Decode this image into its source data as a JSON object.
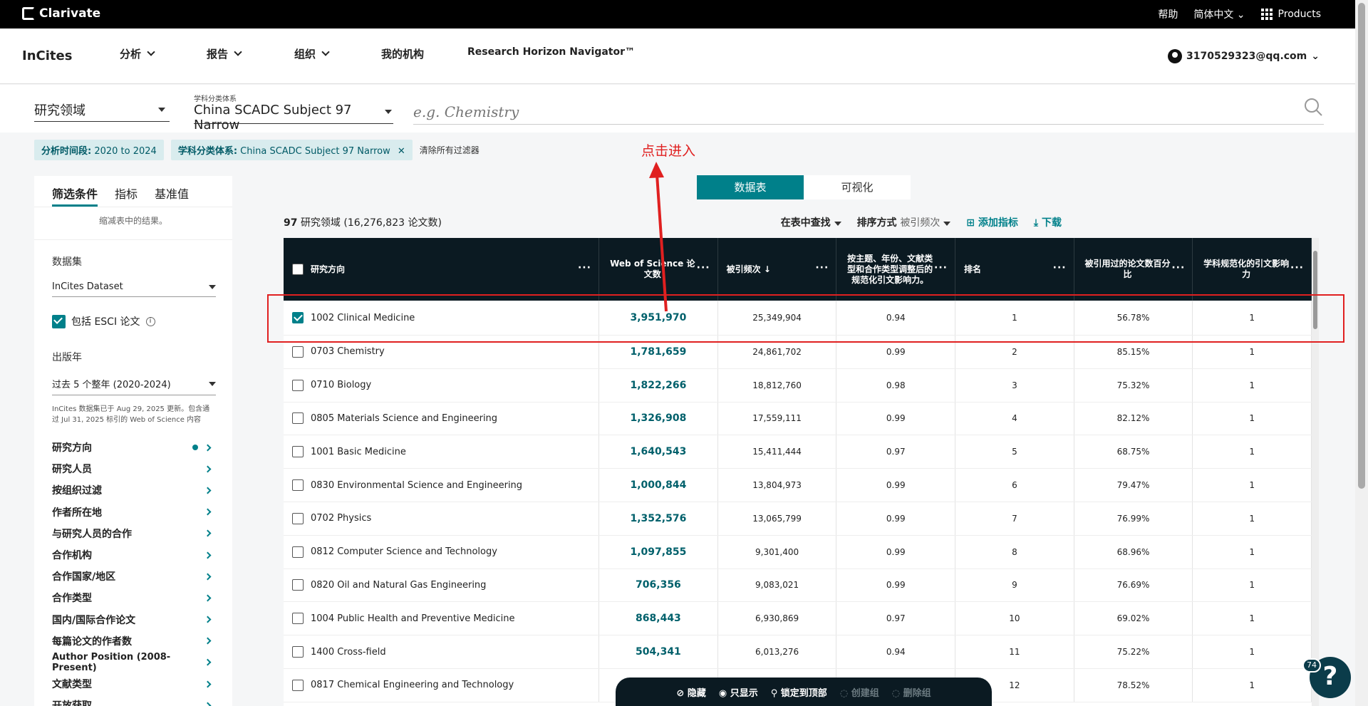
{
  "topbar": {
    "brand": "Clarivate",
    "help": "帮助",
    "lang": "简体中文",
    "products": "Products"
  },
  "nav": {
    "brand": "InCites",
    "items": [
      "分析",
      "报告",
      "组织",
      "我的机构",
      "Research Horizon Navigator™"
    ],
    "user": "3170529323@qq.com"
  },
  "search": {
    "entity": "研究领域",
    "schema_label": "学科分类体系",
    "schema": "China SCADC Subject 97 Narrow",
    "placeholder": "e.g. Chemistry"
  },
  "chips": {
    "period_label": "分析时间段:",
    "period": "2020 to 2024",
    "schema_label": "学科分类体系:",
    "schema": "China SCADC Subject 97 Narrow",
    "clear": "清除所有过滤器"
  },
  "annotation": "点击进入",
  "panel": {
    "tabs": [
      "筛选条件",
      "指标",
      "基准值"
    ],
    "subtitle": "缩减表中的结果。",
    "dataset_label": "数据集",
    "dataset": "InCites Dataset",
    "esci_label": "包括 ESCI 论文",
    "year_label": "出版年",
    "year": "过去 5 个整年 (2020-2024)",
    "note": "InCites 数据集已于 Aug 29, 2025 更新。包含通过 Jul 31, 2025 标引的 Web of Science 内容",
    "filters": [
      "研究方向",
      "研究人员",
      "按组织过滤",
      "作者所在地",
      "与研究人员的合作",
      "合作机构",
      "合作国家/地区",
      "合作类型",
      "国内/国际合作论文",
      "每篇论文的作者数",
      "Author Position (2008-Present)",
      "文献类型",
      "开放获取"
    ]
  },
  "view_toggle": {
    "table": "数据表",
    "viz": "可视化"
  },
  "summary": {
    "count": "97",
    "label": "研究领域 (16,276,823 论文数)"
  },
  "tools": {
    "find": "在表中查找",
    "sort_label": "排序方式",
    "sort_value": "被引频次",
    "add": "添加指标",
    "download": "下载"
  },
  "table": {
    "headers": [
      "研究方向",
      "Web of Science 论文数",
      "被引频次",
      "按主题、年份、文献类型和合作类型调整后的规范化引文影响力。",
      "排名",
      "被引用过的论文数百分比",
      "学科规范化的引文影响力"
    ],
    "rows": [
      {
        "name": "1002 Clinical Medicine",
        "wos": "3,951,970",
        "cites": "25,349,904",
        "cnci": "0.94",
        "rank": "1",
        "pct": "56.78%",
        "dnci": "1",
        "checked": true
      },
      {
        "name": "0703 Chemistry",
        "wos": "1,781,659",
        "cites": "24,861,702",
        "cnci": "0.99",
        "rank": "2",
        "pct": "85.15%",
        "dnci": "1",
        "checked": false
      },
      {
        "name": "0710 Biology",
        "wos": "1,822,266",
        "cites": "18,812,760",
        "cnci": "0.98",
        "rank": "3",
        "pct": "75.32%",
        "dnci": "1",
        "checked": false
      },
      {
        "name": "0805 Materials Science and Engineering",
        "wos": "1,326,908",
        "cites": "17,559,111",
        "cnci": "0.99",
        "rank": "4",
        "pct": "82.12%",
        "dnci": "1",
        "checked": false
      },
      {
        "name": "1001 Basic Medicine",
        "wos": "1,640,543",
        "cites": "15,411,444",
        "cnci": "0.97",
        "rank": "5",
        "pct": "68.75%",
        "dnci": "1",
        "checked": false
      },
      {
        "name": "0830 Environmental Science and Engineering",
        "wos": "1,000,844",
        "cites": "13,804,973",
        "cnci": "0.99",
        "rank": "6",
        "pct": "79.47%",
        "dnci": "1",
        "checked": false
      },
      {
        "name": "0702 Physics",
        "wos": "1,352,576",
        "cites": "13,065,799",
        "cnci": "0.99",
        "rank": "7",
        "pct": "76.99%",
        "dnci": "1",
        "checked": false
      },
      {
        "name": "0812 Computer Science and Technology",
        "wos": "1,097,855",
        "cites": "9,301,400",
        "cnci": "0.99",
        "rank": "8",
        "pct": "68.96%",
        "dnci": "1",
        "checked": false
      },
      {
        "name": "0820 Oil and Natural Gas Engineering",
        "wos": "706,356",
        "cites": "9,083,021",
        "cnci": "0.99",
        "rank": "9",
        "pct": "76.69%",
        "dnci": "1",
        "checked": false
      },
      {
        "name": "1004 Public Health and Preventive Medicine",
        "wos": "868,443",
        "cites": "6,930,869",
        "cnci": "0.97",
        "rank": "10",
        "pct": "69.02%",
        "dnci": "1",
        "checked": false
      },
      {
        "name": "1400 Cross-field",
        "wos": "504,341",
        "cites": "6,013,276",
        "cnci": "0.94",
        "rank": "11",
        "pct": "75.22%",
        "dnci": "1",
        "checked": false
      },
      {
        "name": "0817 Chemical Engineering and Technology",
        "wos": "",
        "cites": "",
        "cnci": "",
        "rank": "12",
        "pct": "78.52%",
        "dnci": "1",
        "checked": false
      }
    ]
  },
  "bottombar": {
    "hide": "隐藏",
    "show_only": "只显示",
    "pin": "锁定到顶部",
    "create_group": "创建组",
    "delete_group": "删除组"
  },
  "help": {
    "badge": "74",
    "icon": "?"
  }
}
